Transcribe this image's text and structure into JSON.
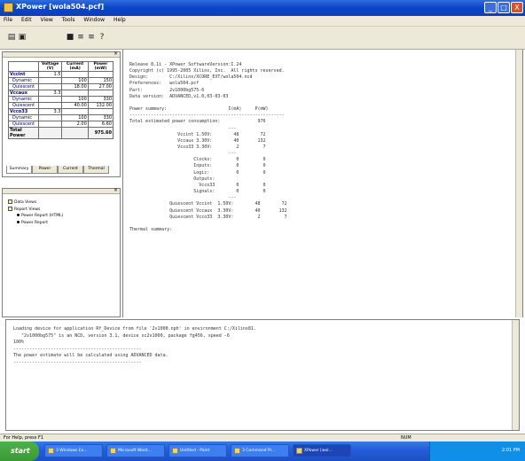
{
  "window": {
    "title": "XPower [wola504.pcf]",
    "min": "_",
    "max": "□",
    "close": "X"
  },
  "menu": [
    "File",
    "Edit",
    "View",
    "Tools",
    "Window",
    "Help"
  ],
  "toolbar": {
    "icons": [
      "open-icon",
      "save-icon",
      "bold-icon",
      "list-icon",
      "align-icon",
      "help-icon"
    ],
    "glyphs": [
      "▤",
      "▣",
      "■",
      "≡",
      "≡",
      "?"
    ]
  },
  "estimates": {
    "header": [
      "",
      "Voltage (V)",
      "Current (mA)",
      "Power (mW)"
    ],
    "rows": [
      {
        "name": "Vccint",
        "vals": [
          "1.5",
          "",
          ""
        ],
        "type": "grp"
      },
      {
        "name": "Dynamic",
        "vals": [
          "",
          "100",
          "150"
        ],
        "type": "sub"
      },
      {
        "name": "Quiescent",
        "vals": [
          "",
          "18.00",
          "27.00"
        ],
        "type": "sub"
      },
      {
        "name": "Vccaux",
        "vals": [
          "3.3",
          "",
          ""
        ],
        "type": "grp"
      },
      {
        "name": "Dynamic",
        "vals": [
          "",
          "100",
          "330"
        ],
        "type": "sub"
      },
      {
        "name": "Quiescent",
        "vals": [
          "",
          "40.00",
          "132.00"
        ],
        "type": "sub"
      },
      {
        "name": "Vcco33",
        "vals": [
          "3.3",
          "",
          ""
        ],
        "type": "grp"
      },
      {
        "name": "Dynamic",
        "vals": [
          "",
          "100",
          "330"
        ],
        "type": "sub"
      },
      {
        "name": "Quiescent",
        "vals": [
          "",
          "2.00",
          "6.60"
        ],
        "type": "sub"
      },
      {
        "name": "Total Power",
        "vals": [
          "",
          "",
          "975.60"
        ],
        "type": "total"
      }
    ]
  },
  "tabs": [
    "Summary",
    "Power",
    "Current",
    "Thermal"
  ],
  "tree": [
    {
      "label": "Data Views",
      "indent": 0,
      "kind": "folder"
    },
    {
      "label": "Report Views",
      "indent": 0,
      "kind": "folder"
    },
    {
      "label": "Power Report (HTML)",
      "indent": 1,
      "kind": "item"
    },
    {
      "label": "Power Report",
      "indent": 1,
      "kind": "item"
    }
  ],
  "report": {
    "lines": [
      "Release 8.1i - XPower SoftwareVersion:I.24",
      "Copyright (c) 1995-2005 Xilinx, Inc.  All rights reserved.",
      "Design:        C:/Xilinx/XCORE_EXT/wola504.ncd",
      "Preferences:   wola504.pcf",
      "Part:          2v1000bg575-6",
      "Data version:  ADVANCED,v1.0,03-03-03",
      "",
      "Power summary:                       I(mA)     P(mW)",
      "----------------------------------------------------------",
      "Total estimated power consumption:              976",
      "                                     ---",
      "                  Vccint 1.50V:        48        72",
      "                  Vccaux 3.30V:        40       132",
      "                  Vcco33 3.30V:         2         7",
      "                                     ---",
      "                        Clocks:         0         0",
      "                        Inputs:         0         0",
      "                        Logic:          0         0",
      "                        Outputs:",
      "                          Vcco33        0         0",
      "                        Signals:        0         0",
      "                                     ---",
      "               Quiescent Vccint  1.50V:        48        72",
      "               Quiescent Vccaux  3.30V:        40       132",
      "               Quiescent Vcco33  3.30V:         2         7",
      "",
      "Thermal summary:"
    ]
  },
  "console": {
    "lines": [
      "Loading device for application Rf_Device from file '2v1000.nph' in environment C:/Xilinx81.",
      "   \"2v1000bg575\" is an NCD, version 3.1, device xc2v1000, package fg456, speed -6",
      "100%",
      "------------------------------------------------",
      "The power estimate will be calculated using ADVANCED data.",
      "------------------------------------------------"
    ]
  },
  "statusbar": {
    "left": "For Help, press F1",
    "right": "NUM"
  },
  "taskbar": {
    "start": "start",
    "buttons": [
      "3 Windows Ex...",
      "Microsoft Word...",
      "Untitled - Paint",
      "3 Command Pr...",
      "XPower [wol..."
    ],
    "tray_time": "2:01 PM"
  }
}
